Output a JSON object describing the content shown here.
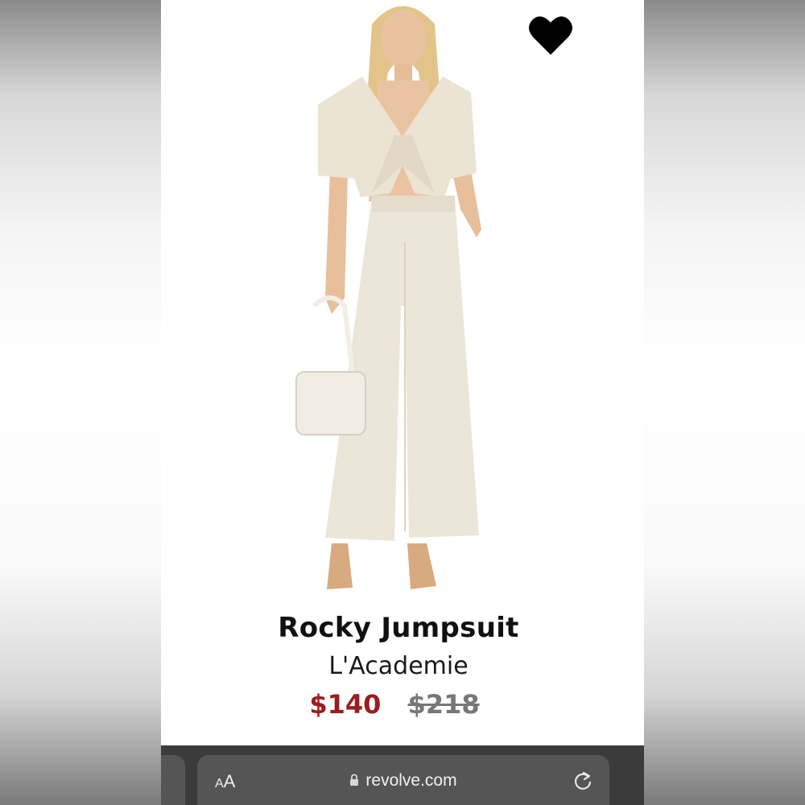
{
  "product": {
    "name": "Rocky Jumpsuit",
    "brand": "L'Academie",
    "sale_price": "$140",
    "original_price": "$218",
    "favorite_icon": "heart-icon"
  },
  "browser": {
    "text_size_small": "A",
    "text_size_large": "A",
    "url": "revolve.com",
    "lock_icon": "lock-icon",
    "reload_icon": "reload-icon"
  },
  "colors": {
    "sale_price": "#9b1d20",
    "original_price": "#777777",
    "browser_bar": "#3b3b3b",
    "address_field": "#555555"
  }
}
